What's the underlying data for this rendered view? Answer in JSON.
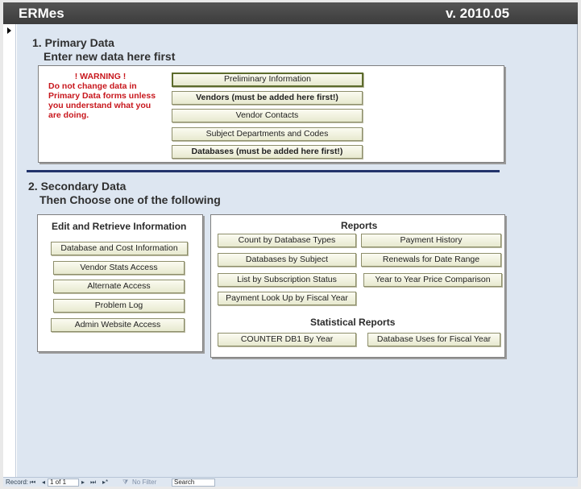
{
  "app": {
    "title": "ERMes",
    "version": "v. 2010.05"
  },
  "primary": {
    "heading": "1. Primary Data",
    "subheading": "Enter new data here first",
    "warning_title": "! WARNING !",
    "warning_text": "Do not change data in Primary Data forms unless you understand what you are doing.",
    "buttons": [
      "Preliminary Information",
      "Vendors (must be added here first!)",
      "Vendor Contacts",
      "Subject Departments and Codes",
      "Databases (must be added here first!)"
    ]
  },
  "secondary": {
    "heading": "2. Secondary Data",
    "subheading": "Then Choose one of the following",
    "edit_panel": {
      "title": "Edit and Retrieve Information",
      "buttons": [
        "Database and Cost Information",
        "Vendor Stats Access",
        "Alternate Access",
        "Problem Log",
        "Admin Website Access"
      ]
    },
    "reports_panel": {
      "title": "Reports",
      "left_buttons": [
        "Count by Database Types",
        "Databases by Subject",
        "List by Subscription Status",
        "Payment Look Up by Fiscal Year"
      ],
      "right_buttons": [
        "Payment History",
        "Renewals for Date Range",
        "Year to Year Price Comparison"
      ],
      "statistical_title": "Statistical Reports",
      "statistical_buttons": [
        "COUNTER DB1 By Year",
        "Database Uses for Fiscal Year"
      ]
    }
  },
  "statusbar": {
    "record_label": "Record:",
    "first": "⏮",
    "prev": "◂",
    "position": "1 of 1",
    "next": "▸",
    "last": "⏭",
    "new": "▸*",
    "filter_icon": "funnel-icon",
    "filter": "No Filter",
    "search": "Search"
  }
}
